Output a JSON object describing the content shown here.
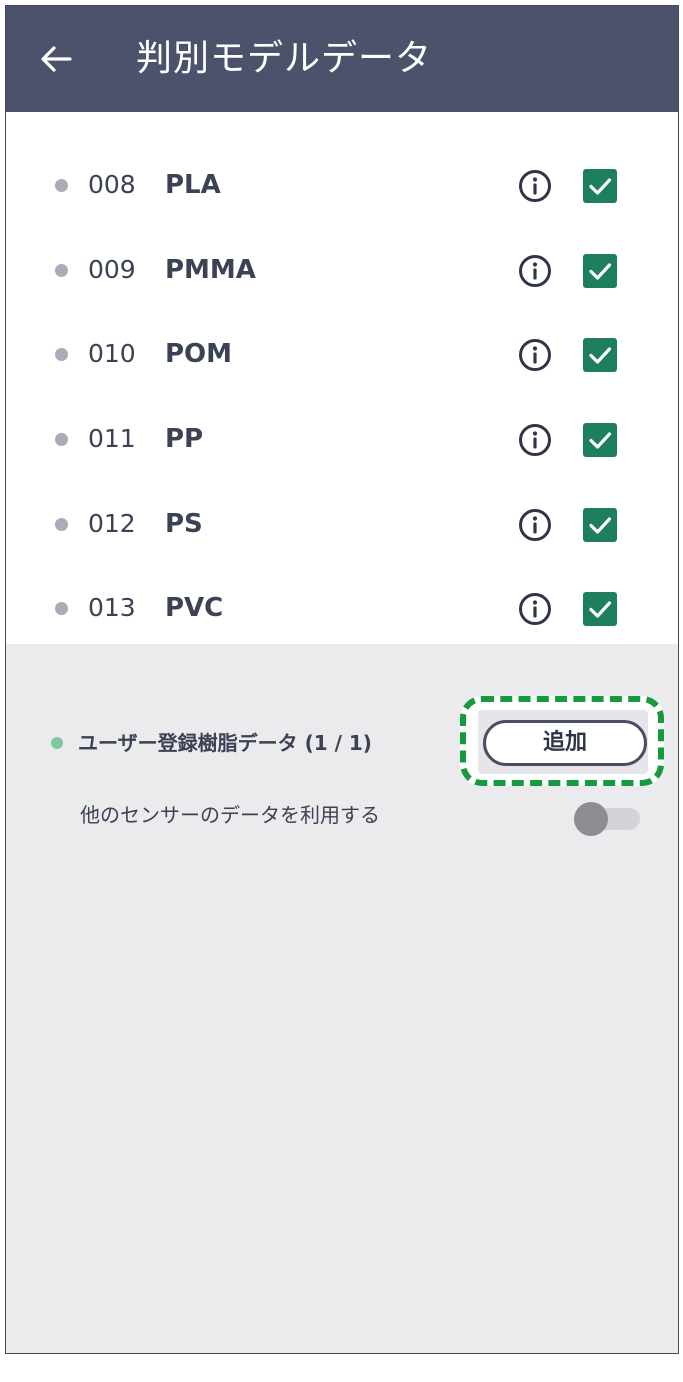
{
  "header": {
    "title": "判別モデルデータ",
    "back_icon": "arrow-left-icon",
    "bg_color": "#4c526c"
  },
  "models": [
    {
      "code": "008",
      "name": "PLA",
      "checked": true
    },
    {
      "code": "009",
      "name": "PMMA",
      "checked": true
    },
    {
      "code": "010",
      "name": "POM",
      "checked": true
    },
    {
      "code": "011",
      "name": "PP",
      "checked": true
    },
    {
      "code": "012",
      "name": "PS",
      "checked": true
    },
    {
      "code": "013",
      "name": "PVC",
      "checked": true
    }
  ],
  "user_data": {
    "label": "ユーザー登録樹脂データ (1 / 1)",
    "add_label": "追加",
    "dot_color": "#7cc79b"
  },
  "sensor": {
    "label": "他のセンサーのデータを利用する",
    "enabled": false
  },
  "colors": {
    "check": "#1e7f5d",
    "highlight": "#17993f",
    "text": "#3b4254"
  }
}
